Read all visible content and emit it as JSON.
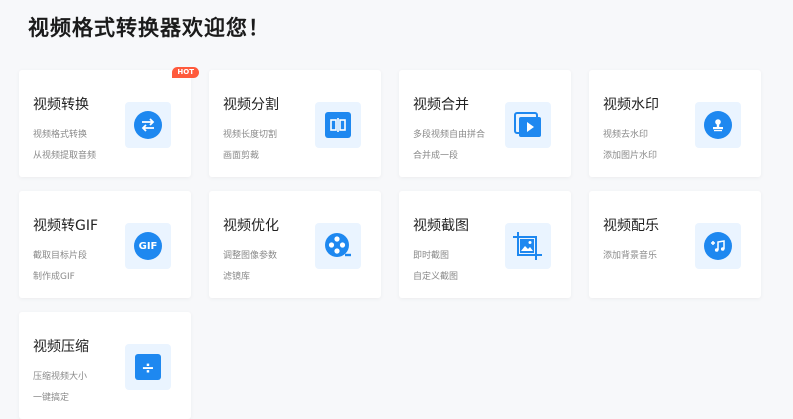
{
  "page": {
    "title": "视频格式转换器欢迎您！"
  },
  "accent_color": "#1e88f0",
  "cards": [
    {
      "title": "视频转换",
      "desc1": "视频格式转换",
      "desc2": "从视频提取音频",
      "icon": "convert-arrows-icon",
      "badge": "HOT"
    },
    {
      "title": "视频分割",
      "desc1": "视频长度切割",
      "desc2": "画面剪裁",
      "icon": "split-icon"
    },
    {
      "title": "视频合并",
      "desc1": "多段视频自由拼合",
      "desc2": "合并成一段",
      "icon": "merge-play-icon"
    },
    {
      "title": "视频水印",
      "desc1": "视频去水印",
      "desc2": "添加图片水印",
      "icon": "stamp-icon"
    },
    {
      "title": "视频转GIF",
      "desc1": "截取目标片段",
      "desc2": "制作成GIF",
      "icon": "gif-icon",
      "icon_text": "GIF"
    },
    {
      "title": "视频优化",
      "desc1": "调整图像参数",
      "desc2": "滤镜库",
      "icon": "film-reel-icon"
    },
    {
      "title": "视频截图",
      "desc1": "即时截图",
      "desc2": "自定义截图",
      "icon": "screenshot-image-icon"
    },
    {
      "title": "视频配乐",
      "desc1": "添加背景音乐",
      "desc2": "",
      "icon": "music-add-icon"
    },
    {
      "title": "视频压缩",
      "desc1": "压缩视频大小",
      "desc2": "一键搞定",
      "icon": "compress-icon",
      "icon_text": "÷"
    }
  ]
}
